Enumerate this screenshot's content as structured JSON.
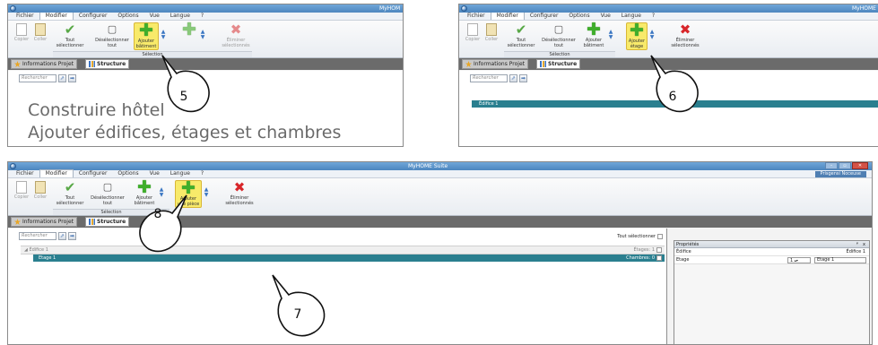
{
  "app": {
    "title_short": "MyHOM",
    "title_short2": "MyHOME",
    "title_full": "MyHOME Suite",
    "user_badge": "Prisgensi Noceuse"
  },
  "menu": [
    "Fichier",
    "Modifier",
    "Configurer",
    "Options",
    "Vue",
    "Langue",
    "?"
  ],
  "ribbon": {
    "copy": "Copier",
    "paste": "Coller",
    "select_all": [
      "Tout",
      "sélectionner"
    ],
    "deselect_all": [
      "Désélectionner",
      "tout"
    ],
    "add_building": [
      "Ajouter",
      "bâtiment"
    ],
    "add_floor": [
      "Ajouter",
      "étage"
    ],
    "add_room": [
      "Ajouter",
      "une pièce"
    ],
    "remove_selected": [
      "Éliminer",
      "sélectionnés"
    ],
    "group_selection": "Sélection"
  },
  "tabs": {
    "project_info": "Informations Projet",
    "structure": "Structure"
  },
  "search": {
    "placeholder": "Rechercher"
  },
  "panel1": {
    "heading": "Construire hôtel",
    "subheading": "Ajouter édifices, étages et chambres"
  },
  "tree": {
    "building": "Édifice 1",
    "floor": "Etage 1",
    "floors_label": "Étages:",
    "floors_count": "1",
    "rooms_label": "Chambres:",
    "rooms_count": "0",
    "select_all": "Tout sélectionner"
  },
  "properties": {
    "title": "Propriétés",
    "pin": "ᵠ",
    "close": "x",
    "building_label": "Édifice",
    "building_value": "Édifice 1",
    "floor_label": "Etage",
    "floor_number": "1",
    "floor_value": "Etage 1"
  },
  "callouts": {
    "c5": "5",
    "c6": "6",
    "c7": "7",
    "c8": "8"
  },
  "colors": {
    "accent_teal": "#2a7f8f",
    "highlight_yellow": "#f8ea6a",
    "tab_bar": "#6b6b6b"
  }
}
